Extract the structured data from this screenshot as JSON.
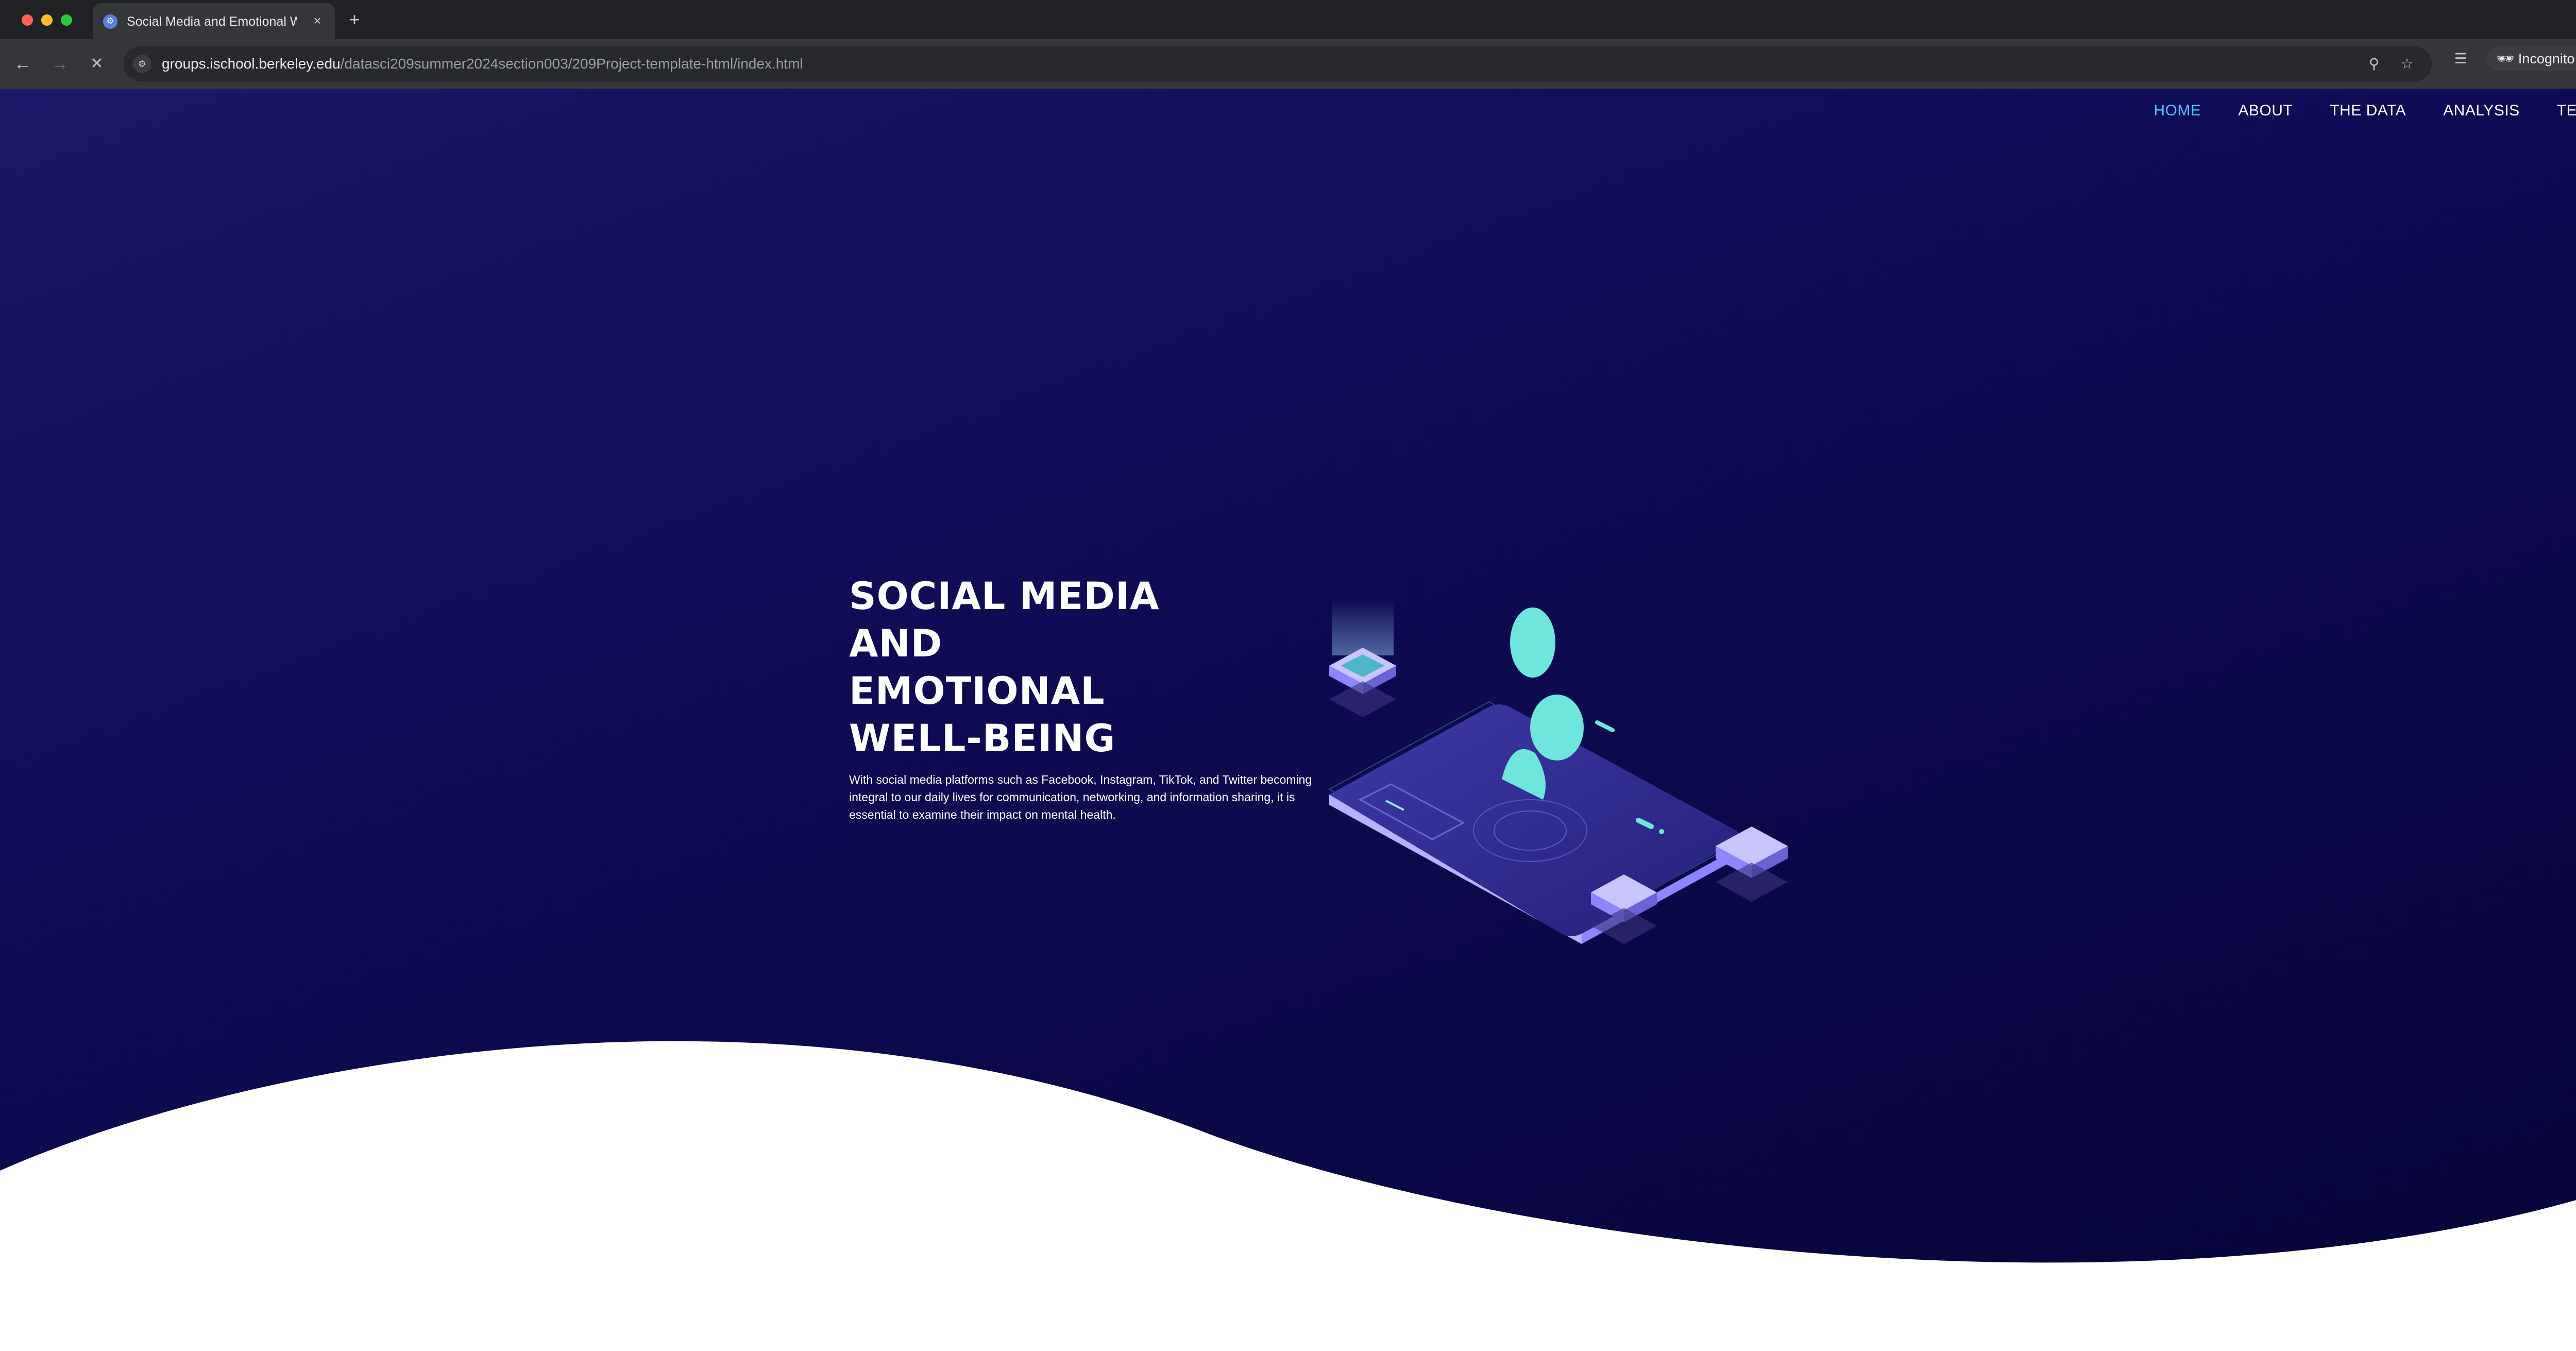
{
  "browser": {
    "tab_title": "Social Media and Emotional Well-being",
    "tab_close_icon": "×",
    "new_tab_icon": "+",
    "tab_menu_icon": "⌄",
    "url_host": "groups.ischool.berkeley.edu",
    "url_path": "/datasci209summer2024section003/209Project-template-html/index.html",
    "incognito_label": "Incognito",
    "icons": {
      "back": "←",
      "forward": "→",
      "reload": "✕",
      "site_info": "⚙",
      "zoom": "⚲",
      "bookmark": "☆",
      "reading_list": "☰",
      "menu": "⋮",
      "incognito": "🕶"
    }
  },
  "nav": {
    "items": [
      {
        "label": "HOME",
        "active": true
      },
      {
        "label": "ABOUT",
        "active": false
      },
      {
        "label": "THE DATA",
        "active": false
      },
      {
        "label": "ANALYSIS",
        "active": false
      },
      {
        "label": "TEAM",
        "active": false
      }
    ]
  },
  "hero": {
    "title_lines": [
      "SOCIAL MEDIA",
      "AND",
      "EMOTIONAL",
      "WELL-BEING"
    ],
    "description": "With social media platforms such as Facebook, Instagram, TikTok, and Twitter becoming integral to our daily lives for communication, networking, and information sharing, it is essential to examine their impact on mental health."
  },
  "colors": {
    "background_top": "#1b1868",
    "background_bottom": "#070438",
    "nav_active": "#4dc7ff",
    "accent_teal": "#6fe6dc",
    "accent_purple": "#8e86ff",
    "wave": "#ffffff"
  }
}
